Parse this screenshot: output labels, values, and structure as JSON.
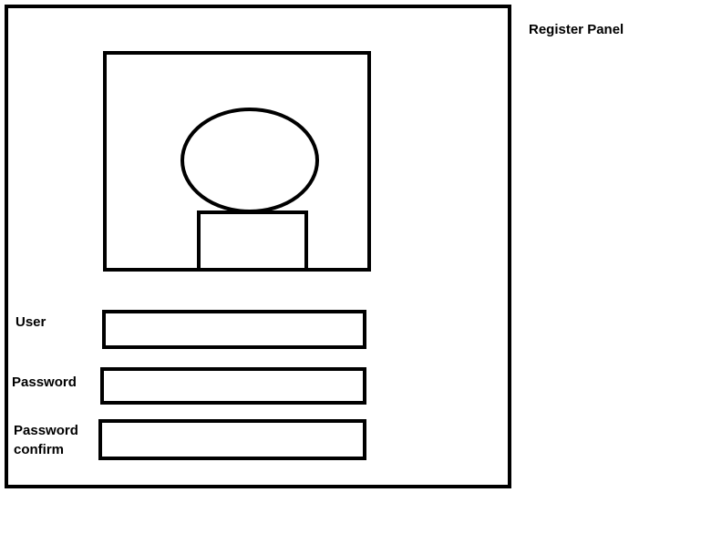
{
  "panel": {
    "title": "Register Panel"
  },
  "avatar": {
    "icon": "user-avatar-icon"
  },
  "form": {
    "user_label": "User",
    "user_value": "",
    "password_label": "Password",
    "password_value": "",
    "password_confirm_label": "Password\nconfirm",
    "password_confirm_value": ""
  }
}
